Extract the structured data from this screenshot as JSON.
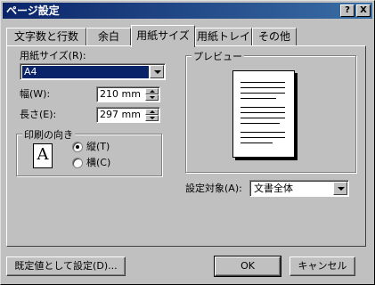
{
  "title": "ページ設定",
  "title_buttons": {
    "help": "?",
    "close": "X"
  },
  "tabs": [
    {
      "label": "文字数と行数"
    },
    {
      "label": "余白"
    },
    {
      "label": "用紙サイズ"
    },
    {
      "label": "用紙トレイ"
    },
    {
      "label": "その他"
    }
  ],
  "paper_size": {
    "label": "用紙サイズ(R):",
    "value": "A4"
  },
  "width": {
    "label": "幅(W):",
    "value": "210 mm"
  },
  "height": {
    "label": "長さ(E):",
    "value": "297 mm"
  },
  "orientation": {
    "group_label": "印刷の向き",
    "icon_letter": "A",
    "options": [
      {
        "label": "縦(T)",
        "selected": true
      },
      {
        "label": "横(C)",
        "selected": false
      }
    ]
  },
  "preview": {
    "label": "プレビュー"
  },
  "apply_to": {
    "label": "設定対象(A):",
    "value": "文書全体"
  },
  "buttons": {
    "default": "既定値として設定(D)...",
    "ok": "OK",
    "cancel": "キャンセル"
  },
  "colors": {
    "titlebar_start": "#0a246a",
    "titlebar_end": "#3a6ea5",
    "face": "#c0c0c0",
    "selection": "#0a246a"
  }
}
